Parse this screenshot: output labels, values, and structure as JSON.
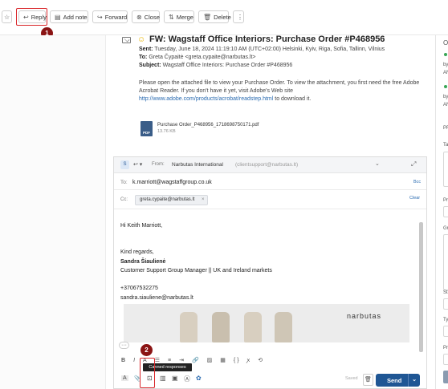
{
  "toolbar": {
    "buttons": [
      {
        "label": "",
        "icon": "star-icon"
      },
      {
        "label": "Reply",
        "icon": "reply-icon"
      },
      {
        "label": "Add note",
        "icon": "note-icon"
      },
      {
        "label": "Forward",
        "icon": "forward-icon"
      },
      {
        "label": "Close",
        "icon": "close-circle-icon"
      },
      {
        "label": "Merge",
        "icon": "merge-icon"
      },
      {
        "label": "Delete",
        "icon": "trash-icon"
      },
      {
        "label": "⋮",
        "icon": "more-icon"
      }
    ],
    "step1_badge": "1"
  },
  "message": {
    "subject": "FW: Wagstaff Office Interiors: Purchase Order #P468956",
    "sent_label": "Sent:",
    "sent_value": "Tuesday, June 18, 2024 11:19:10 AM (UTC+02:00) Helsinki, Kyiv, Riga, Sofia, Tallinn, Vilnius",
    "to_label": "To:",
    "to_value": "Greta Čypaitė <greta.cypaite@narbutas.lt>",
    "subject_label": "Subject:",
    "subject_value": "Wagstaff Office Interiors: Purchase Order #P468956",
    "body_line1": "Please open the attached file to view your Purchase Order. To view the attachment, you first need the free Adobe",
    "body_line2": "Acrobat Reader. If you don't have it yet, visit Adobe's Web site",
    "body_link": "http://www.adobe.com/products/acrobat/readstep.html",
    "body_link_suffix": " to download it.",
    "attachment_name": "Purchase Order_P468956_1718698750171.pdf",
    "attachment_size": "13.76 KB",
    "attachment_type": "PDF"
  },
  "compose": {
    "from_label": "From:",
    "from_name": "Narbutas International",
    "from_email": "(clientsupport@narbutas.lt)",
    "to_label": "To:",
    "to_value": "k.marriott@wagstaffgroup.co.uk",
    "bcc_label": "Bcc",
    "cc_label": "Cc:",
    "cc_chip": "greta.cypaite@narbutas.lt",
    "clear_label": "Clear",
    "greeting": "Hi Keith Marriott,",
    "regards": "Kind regards,",
    "sig_name": "Sandra Šiaulienė",
    "sig_title": "Customer Support Group Manager || UK and Ireland markets",
    "sig_phone": "+37067532275",
    "sig_email": "sandra.siauliene@narbutas.lt",
    "banner_brand": "narbutas",
    "more_dots": "···",
    "tooltip": "Canned responses",
    "step2_badge": "2",
    "saved_label": "Saved",
    "send_label": "Send",
    "format_bold": "B",
    "format_italic": "I"
  },
  "right_panel": {
    "letters": [
      "O",
      "by",
      "AN",
      "by",
      "AN",
      "PR",
      "Ta",
      "Pr",
      "Gr",
      "St",
      "Ty",
      "Pr"
    ]
  },
  "colors": {
    "accent": "#1f5694",
    "highlight": "#d9262a",
    "badge": "#8b1414"
  }
}
